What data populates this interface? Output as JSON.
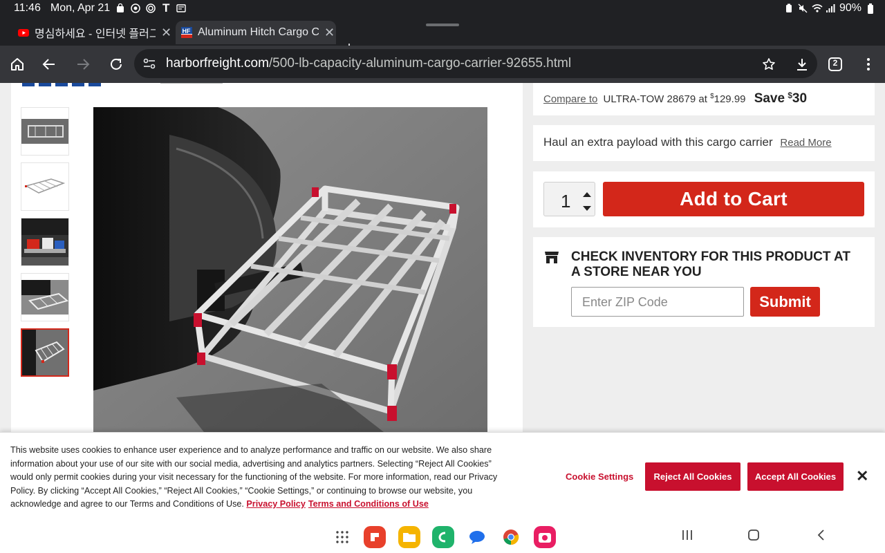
{
  "status_bar": {
    "time": "11:46",
    "date": "Mon, Apr 21",
    "battery": "90%"
  },
  "tabs": [
    {
      "title": "명심하세요 - 인터넷 플러그를",
      "favicon": "youtube-icon",
      "active": false
    },
    {
      "title": "Aluminum Hitch Cargo Ca",
      "favicon": "harbor-freight-icon",
      "active": true
    }
  ],
  "tab_count": "2",
  "address_bar": {
    "host": "harborfreight.com",
    "path": "/500-lb-capacity-aluminum-cargo-carrier-92655.html"
  },
  "product": {
    "compare_label": "Compare to",
    "compare_text": "ULTRA-TOW 28679 at",
    "compare_currency": "$",
    "compare_price": "129.99",
    "save_label": "Save",
    "save_currency": "$",
    "save_amount": "30",
    "tagline": "Haul an extra payload with this cargo carrier",
    "read_more": "Read More",
    "quantity": "1",
    "add_to_cart": "Add to Cart",
    "inventory_title": "CHECK INVENTORY FOR THIS PRODUCT AT A STORE NEAR YOU",
    "zip_placeholder": "Enter ZIP Code",
    "submit": "Submit"
  },
  "cookie_banner": {
    "text": "This website uses cookies to enhance user experience and to analyze performance and traffic on our website. We also share information about your use of our site with our social media, advertising and analytics partners. Selecting “Reject All Cookies” would only permit cookies during your visit necessary for the functioning of the website. For more information, read our Privacy Policy. By clicking “Accept All Cookies,” “Reject All Cookies,” “Cookie Settings,” or continuing to browse our website, you acknowledge and agree to our Terms and Conditions of Use.",
    "privacy_link": "Privacy Policy",
    "terms_link": "Terms and Conditions of Use",
    "cookie_settings": "Cookie Settings",
    "reject": "Reject All Cookies",
    "accept": "Accept All Cookies"
  },
  "colors": {
    "brand_red": "#d3271a",
    "cookie_red": "#c8102e"
  }
}
